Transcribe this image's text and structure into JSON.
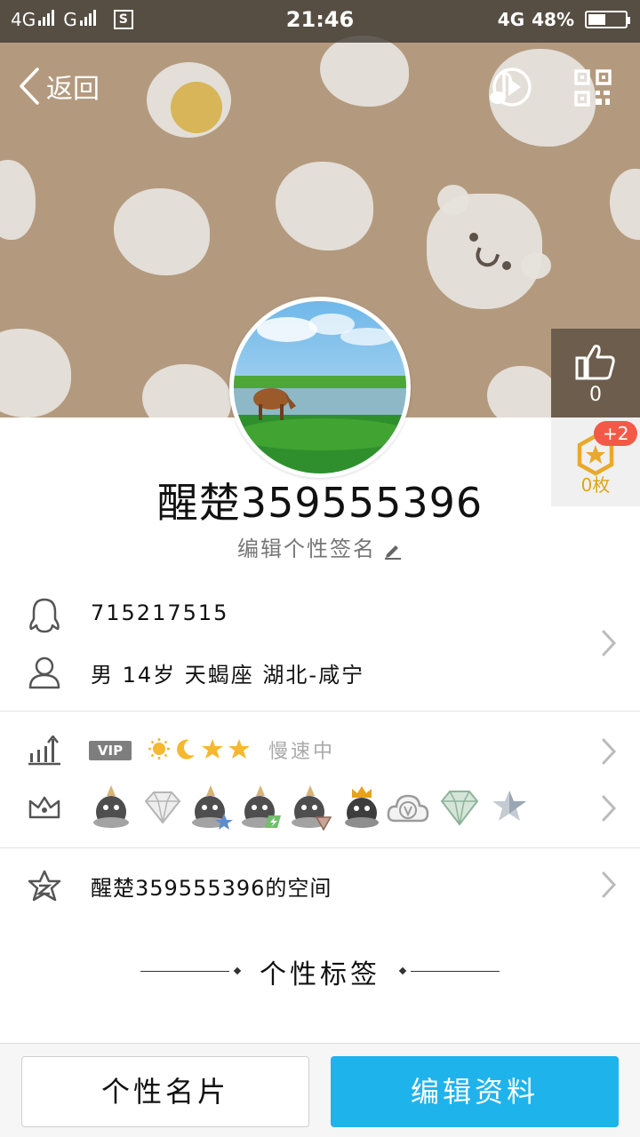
{
  "status_bar": {
    "network_1": "4G",
    "network_2": "G",
    "screenshot_badge": "S",
    "time": "21:46",
    "network_right": "4G",
    "battery": "48%",
    "battery_level": 0.48
  },
  "nav": {
    "back_label": "返回"
  },
  "like": {
    "count": "0"
  },
  "badge": {
    "plus": "+2",
    "count": "0枚"
  },
  "profile": {
    "nickname": "醒楚359555396",
    "signature": "编辑个性签名"
  },
  "info": {
    "qq_number": "715217515",
    "details": "男  14岁  天蝎座  湖北-咸宁"
  },
  "vip": {
    "tag": "VIP",
    "status": "慢速中",
    "level_icons": [
      "sun",
      "moon",
      "star",
      "star"
    ]
  },
  "medals": [
    "penguin-gold",
    "diamond",
    "penguin-blue-star",
    "penguin-green-bolt",
    "penguin-red-gem",
    "penguin-crown",
    "cloud-v",
    "diamond-green",
    "star-grey"
  ],
  "space": {
    "label": "醒楚359555396的空间"
  },
  "tags_section": {
    "title": "个性标签"
  },
  "actions": {
    "card_label": "个性名片",
    "edit_label": "编辑资料"
  },
  "colors": {
    "accent": "#1fb3ec",
    "header_bg": "#b39a7e",
    "badge_red": "#f25a47",
    "gold": "#e0a519"
  }
}
